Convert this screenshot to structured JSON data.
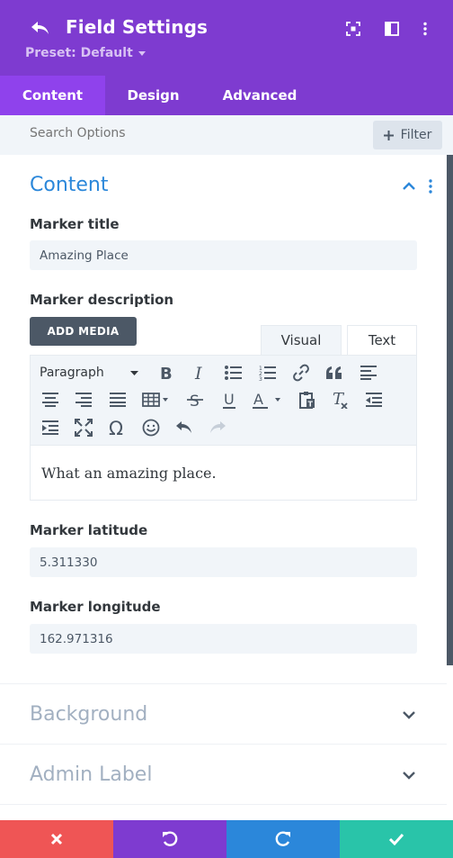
{
  "header": {
    "title": "Field Settings",
    "preset_label": "Preset: Default",
    "icons": [
      "back-arrow-icon",
      "focus-icon",
      "layout-icon",
      "more-vertical-icon"
    ]
  },
  "tabs": [
    {
      "label": "Content",
      "active": true
    },
    {
      "label": "Design",
      "active": false
    },
    {
      "label": "Advanced",
      "active": false
    }
  ],
  "search": {
    "placeholder": "Search Options",
    "filter_label": "Filter"
  },
  "content_section": {
    "title": "Content",
    "marker_title": {
      "label": "Marker title",
      "value": "Amazing Place"
    },
    "marker_description": {
      "label": "Marker description",
      "add_media_label": "ADD MEDIA",
      "tab_visual": "Visual",
      "tab_text": "Text",
      "format_select": "Paragraph",
      "body": "What an amazing place."
    },
    "marker_latitude": {
      "label": "Marker latitude",
      "value": "5.311330"
    },
    "marker_longitude": {
      "label": "Marker longitude",
      "value": "162.971316"
    }
  },
  "collapsed_sections": [
    {
      "title": "Background"
    },
    {
      "title": "Admin Label"
    }
  ],
  "colors": {
    "primary_purple": "#7e3bd0",
    "active_tab": "#8f42ec",
    "accent_blue": "#2b87da",
    "discard_red": "#ef5555",
    "save_green": "#29c4a9"
  }
}
